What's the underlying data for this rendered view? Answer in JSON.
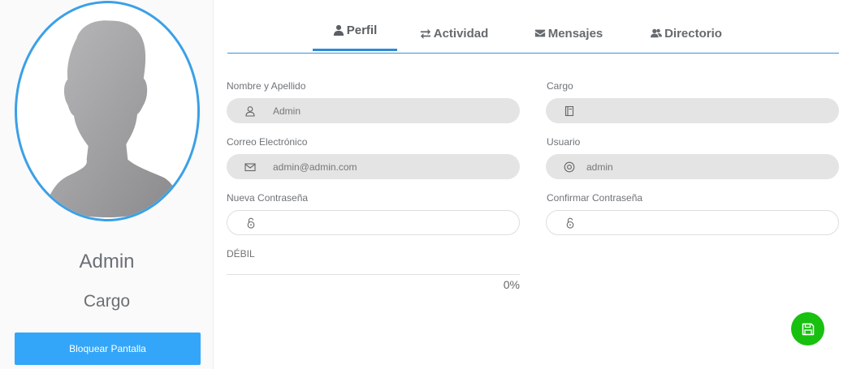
{
  "profile": {
    "name": "Admin",
    "role": "Cargo",
    "lock_button": "Bloquear Pantalla",
    "avatar_icon": "default-user-silhouette"
  },
  "tabs": [
    {
      "label": "Perfil",
      "icon": "user-icon",
      "active": true
    },
    {
      "label": "Actividad",
      "icon": "exchange-icon",
      "active": false
    },
    {
      "label": "Mensajes",
      "icon": "envelope-icon",
      "active": false
    },
    {
      "label": "Directorio",
      "icon": "users-icon",
      "active": false
    }
  ],
  "form": {
    "full_name": {
      "label": "Nombre y Apellido",
      "value": "Admin",
      "icon": "user-outline-icon"
    },
    "position": {
      "label": "Cargo",
      "value": "",
      "icon": "book-icon"
    },
    "email": {
      "label": "Correo Electrónico",
      "value": "admin@admin.com",
      "icon": "envelope-outline-icon"
    },
    "username": {
      "label": "Usuario",
      "value": "admin",
      "icon": "at-sign-icon"
    },
    "new_password": {
      "label": "Nueva Contraseña",
      "value": "",
      "icon": "unlock-icon"
    },
    "confirm_password": {
      "label": "Confirmar Contraseña",
      "value": "",
      "icon": "unlock-icon"
    }
  },
  "password_strength": {
    "label": "DÉBIL",
    "percent_text": "0%",
    "percent": 0
  },
  "save_button": {
    "icon": "floppy-disk-icon"
  },
  "colors": {
    "accent_blue": "#33a6fa",
    "avatar_border": "#3ba0e6",
    "save_green": "#18c10f",
    "field_fill": "#e4e4e4"
  }
}
